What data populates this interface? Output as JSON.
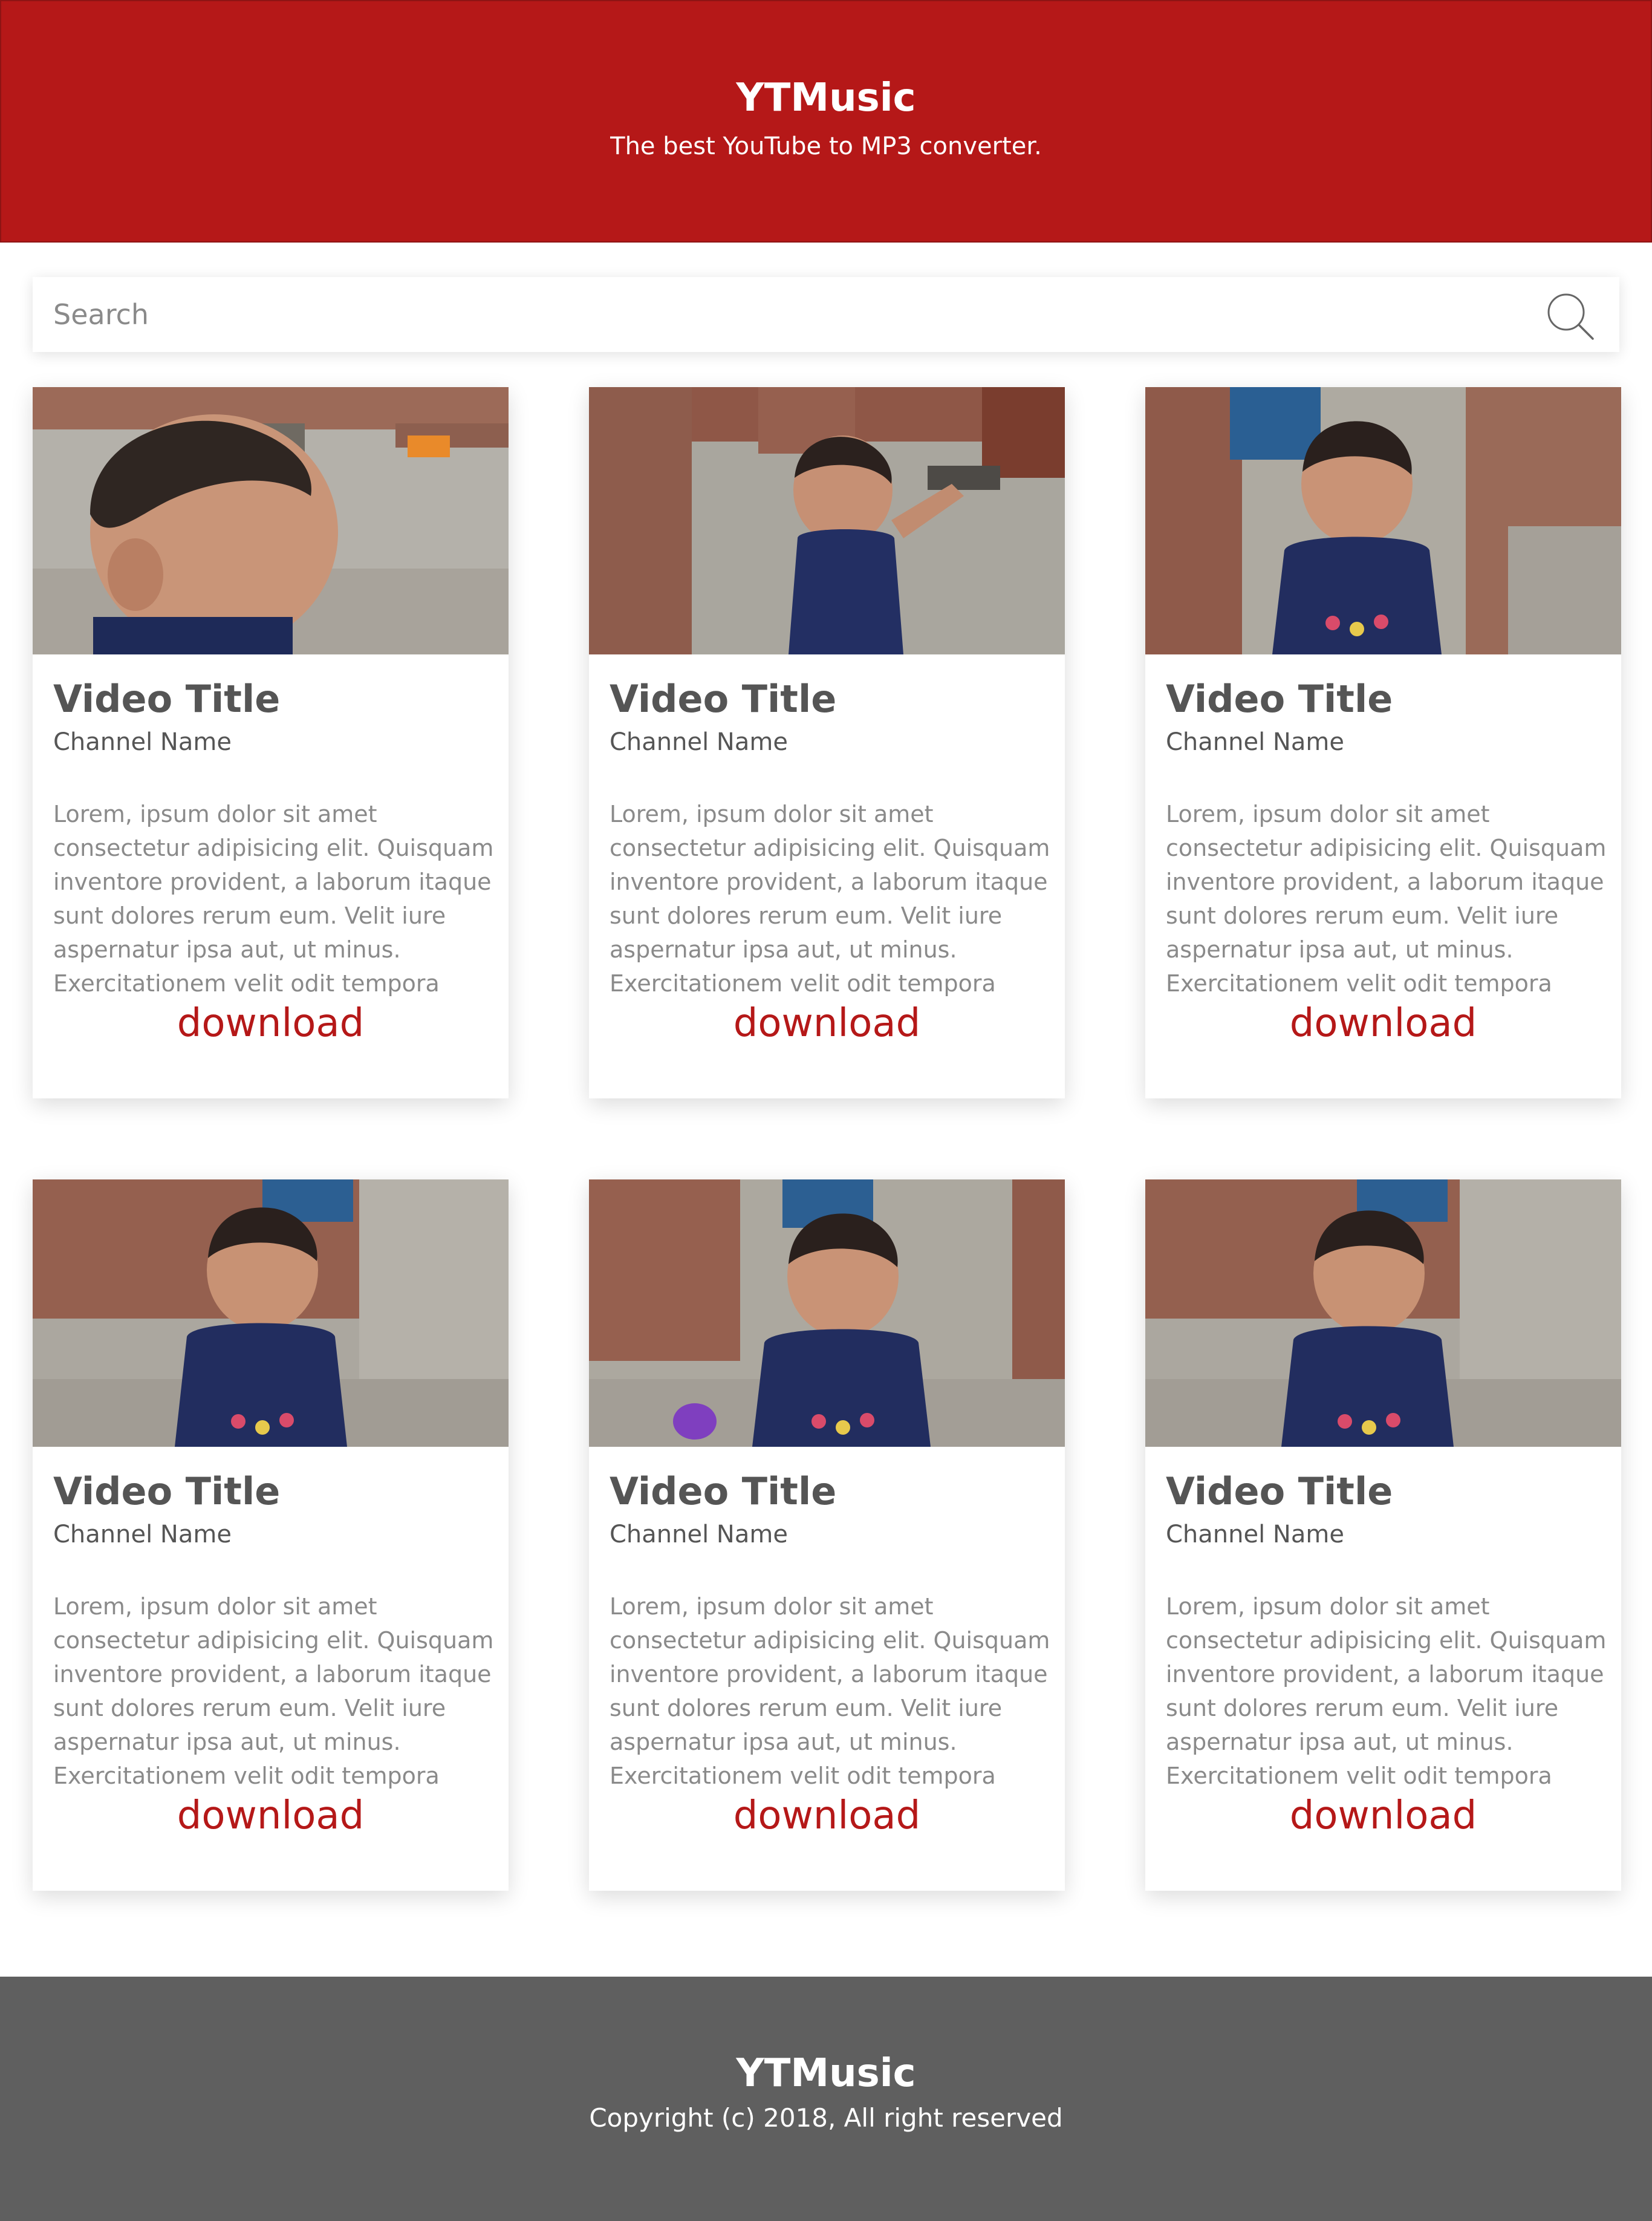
{
  "header": {
    "brand": "YTMusic",
    "tagline": "The best YouTube to MP3 converter."
  },
  "search": {
    "placeholder": "Search",
    "icon": "search-icon"
  },
  "cards": [
    {
      "thumbnail": "photo of smiling toddler",
      "title": "Video Title",
      "channel": "Channel Name",
      "description": "Lorem, ipsum dolor sit amet\nconsectetur adipisicing elit. Quisquam\ninventore provident, a laborum itaque\nsunt dolores rerum eum. Velit iure\naspernatur ipsa aut, ut minus.\nExercitationem velit odit tempora",
      "action": "download"
    },
    {
      "thumbnail": "photo of smiling toddler",
      "title": "Video Title",
      "channel": "Channel Name",
      "description": "Lorem, ipsum dolor sit amet\nconsectetur adipisicing elit. Quisquam\ninventore provident, a laborum itaque\nsunt dolores rerum eum. Velit iure\naspernatur ipsa aut, ut minus.\nExercitationem velit odit tempora",
      "action": "download"
    },
    {
      "thumbnail": "photo of smiling toddler",
      "title": "Video Title",
      "channel": "Channel Name",
      "description": "Lorem, ipsum dolor sit amet\nconsectetur adipisicing elit. Quisquam\ninventore provident, a laborum itaque\nsunt dolores rerum eum. Velit iure\naspernatur ipsa aut, ut minus.\nExercitationem velit odit tempora",
      "action": "download"
    },
    {
      "thumbnail": "photo of smiling toddler",
      "title": "Video Title",
      "channel": "Channel Name",
      "description": "Lorem, ipsum dolor sit amet\nconsectetur adipisicing elit. Quisquam\ninventore provident, a laborum itaque\nsunt dolores rerum eum. Velit iure\naspernatur ipsa aut, ut minus.\nExercitationem velit odit tempora",
      "action": "download"
    },
    {
      "thumbnail": "photo of smiling toddler",
      "title": "Video Title",
      "channel": "Channel Name",
      "description": "Lorem, ipsum dolor sit amet\nconsectetur adipisicing elit. Quisquam\ninventore provident, a laborum itaque\nsunt dolores rerum eum. Velit iure\naspernatur ipsa aut, ut minus.\nExercitationem velit odit tempora",
      "action": "download"
    },
    {
      "thumbnail": "photo of smiling toddler",
      "title": "Video Title",
      "channel": "Channel Name",
      "description": "Lorem, ipsum dolor sit amet\nconsectetur adipisicing elit. Quisquam\ninventore provident, a laborum itaque\nsunt dolores rerum eum. Velit iure\naspernatur ipsa aut, ut minus.\nExercitationem velit odit tempora",
      "action": "download"
    }
  ],
  "footer": {
    "brand": "YTMusic",
    "copyright": "Copyright (c) 2018, All right reserved"
  },
  "colors": {
    "brand_red": "#b51818",
    "footer_gray": "#5f5f5f",
    "title_gray": "#555555",
    "muted_gray": "#8a8a8a"
  }
}
